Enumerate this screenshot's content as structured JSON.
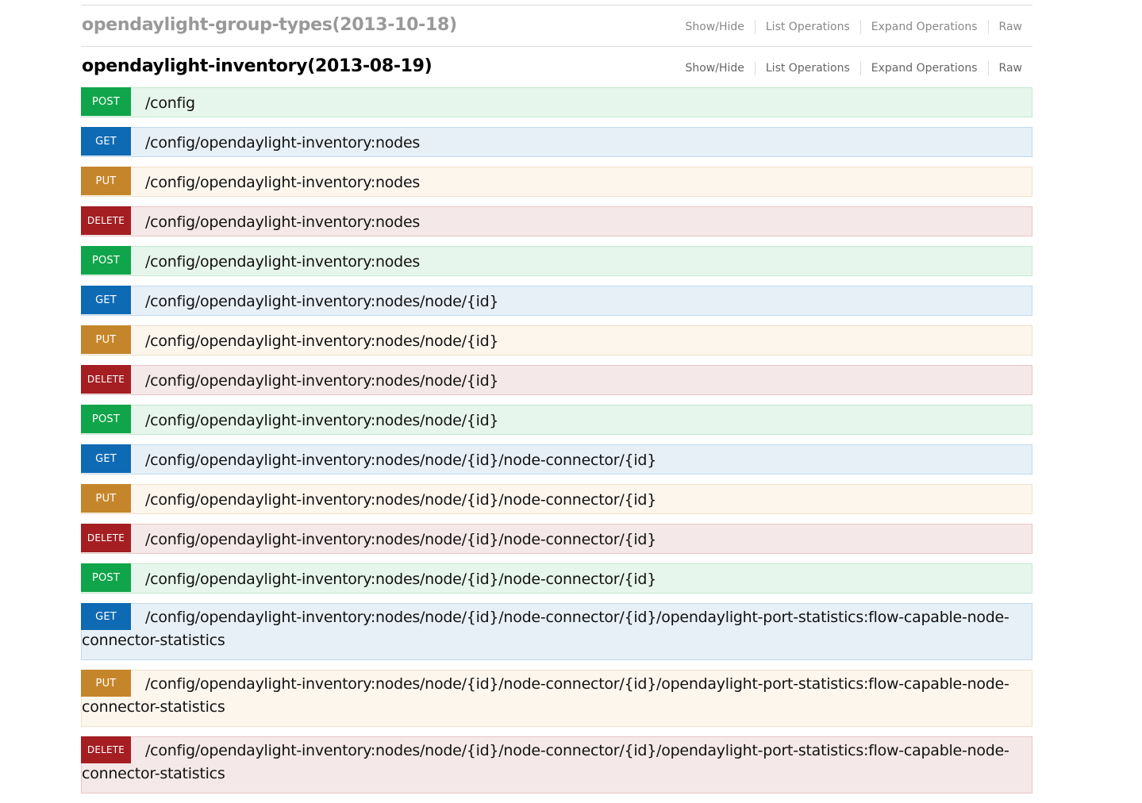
{
  "links": {
    "show_hide": "Show/Hide",
    "list_operations": "List Operations",
    "expand_operations": "Expand Operations",
    "raw": "Raw"
  },
  "resources": [
    {
      "title": "opendaylight-group-types(2013-10-18)"
    },
    {
      "title": "opendaylight-inventory(2013-08-19)"
    }
  ],
  "operations": [
    {
      "method": "POST",
      "path": "/config"
    },
    {
      "method": "GET",
      "path": "/config/opendaylight-inventory:nodes"
    },
    {
      "method": "PUT",
      "path": "/config/opendaylight-inventory:nodes"
    },
    {
      "method": "DELETE",
      "path": "/config/opendaylight-inventory:nodes"
    },
    {
      "method": "POST",
      "path": "/config/opendaylight-inventory:nodes"
    },
    {
      "method": "GET",
      "path": "/config/opendaylight-inventory:nodes/node/{id}"
    },
    {
      "method": "PUT",
      "path": "/config/opendaylight-inventory:nodes/node/{id}"
    },
    {
      "method": "DELETE",
      "path": "/config/opendaylight-inventory:nodes/node/{id}"
    },
    {
      "method": "POST",
      "path": "/config/opendaylight-inventory:nodes/node/{id}"
    },
    {
      "method": "GET",
      "path": "/config/opendaylight-inventory:nodes/node/{id}/node-connector/{id}"
    },
    {
      "method": "PUT",
      "path": "/config/opendaylight-inventory:nodes/node/{id}/node-connector/{id}"
    },
    {
      "method": "DELETE",
      "path": "/config/opendaylight-inventory:nodes/node/{id}/node-connector/{id}"
    },
    {
      "method": "POST",
      "path": "/config/opendaylight-inventory:nodes/node/{id}/node-connector/{id}"
    },
    {
      "method": "GET",
      "path": "/config/opendaylight-inventory:nodes/node/{id}/node-connector/{id}/opendaylight-port-statistics:flow-capable-node-connector-statistics"
    },
    {
      "method": "PUT",
      "path": "/config/opendaylight-inventory:nodes/node/{id}/node-connector/{id}/opendaylight-port-statistics:flow-capable-node-connector-statistics"
    },
    {
      "method": "DELETE",
      "path": "/config/opendaylight-inventory:nodes/node/{id}/node-connector/{id}/opendaylight-port-statistics:flow-capable-node-connector-statistics"
    }
  ],
  "colors": {
    "post": "#10a54a",
    "get": "#0f6ab4",
    "put": "#c5862b",
    "delete": "#a41e22"
  }
}
